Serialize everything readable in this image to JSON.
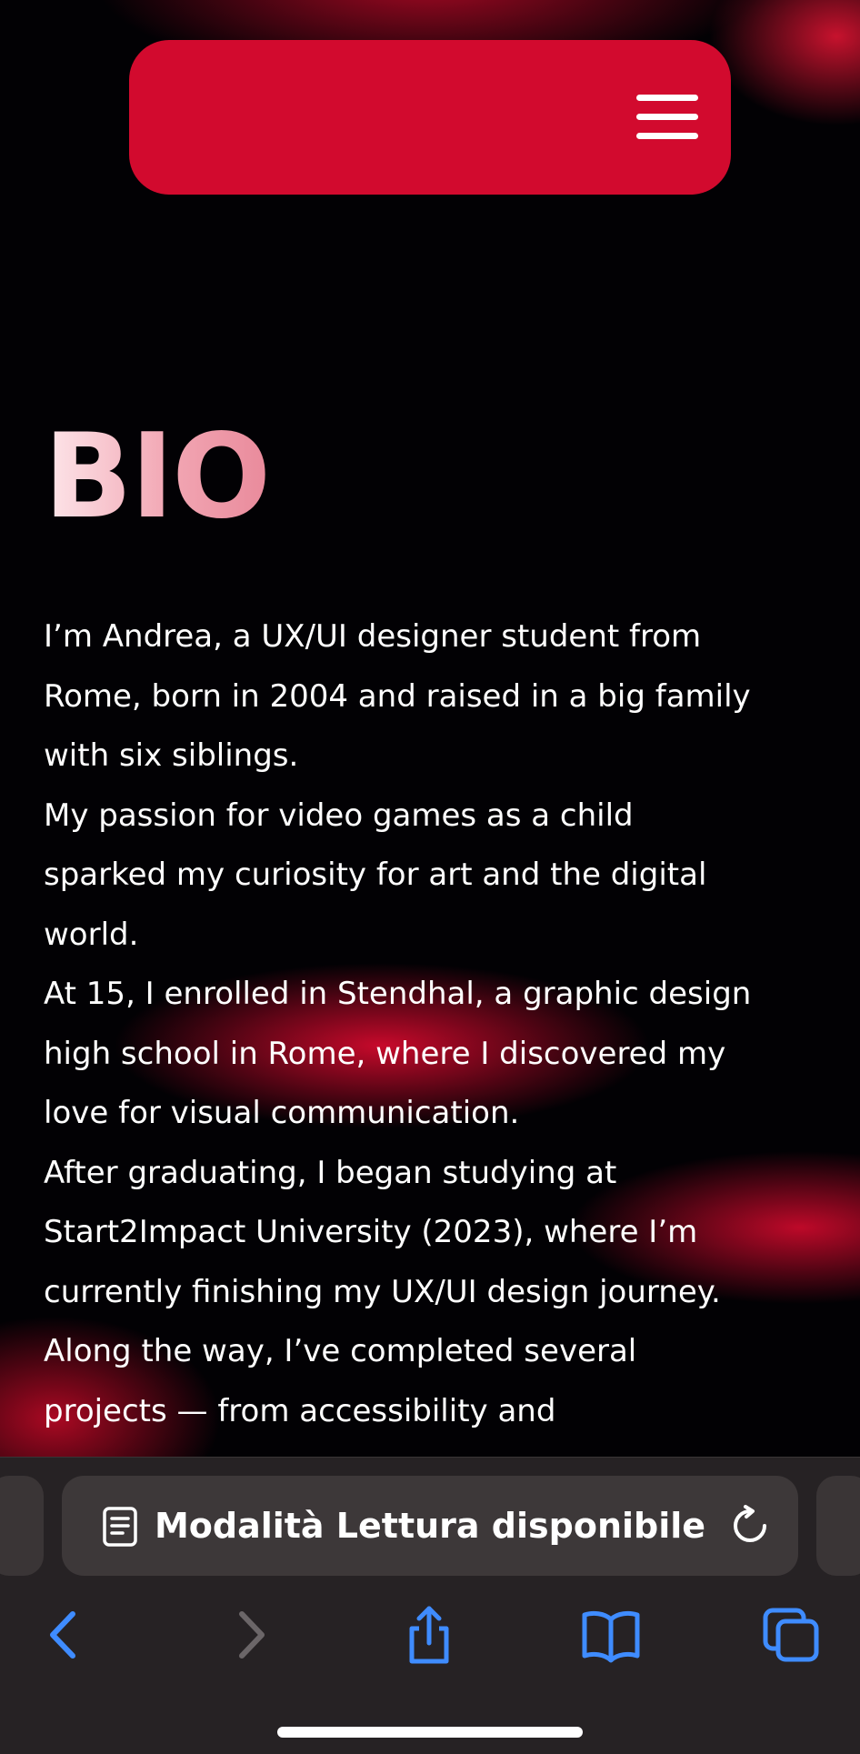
{
  "header": {
    "menu_icon": "hamburger-menu-icon",
    "accent_color": "#d20a2e"
  },
  "bio": {
    "title": "BIO",
    "lines": [
      "I’m Andrea, a UX/UI designer student from",
      "Rome, born in 2004 and raised in a big family",
      "with six siblings.",
      "My passion for video games as a child",
      "sparked my curiosity for art and the digital",
      "world.",
      "At 15, I enrolled in Stendhal, a graphic design",
      "high school in Rome, where I discovered my",
      "love for visual communication.",
      "After graduating, I began studying at",
      "Start2Impact University (2023), where I’m",
      "currently finishing my UX/UI design journey.",
      "Along the way, I’ve completed several",
      "projects — from accessibility and"
    ]
  },
  "browser": {
    "address_text": "Modalità Lettura disponibile",
    "icons": {
      "reader": "reader-mode-icon",
      "reload": "reload-icon",
      "back": "back-chevron-icon",
      "forward": "forward-chevron-icon",
      "share": "share-icon",
      "bookmarks": "bookmarks-book-icon",
      "tabs": "tabs-icon"
    },
    "link_color": "#3f8cff",
    "disabled_color": "#6b6668"
  }
}
